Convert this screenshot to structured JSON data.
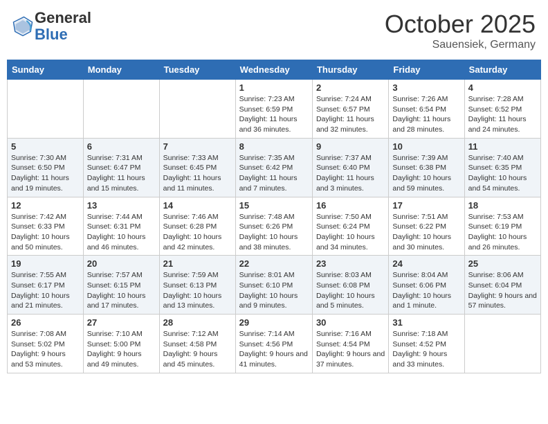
{
  "header": {
    "logo_general": "General",
    "logo_blue": "Blue",
    "month": "October 2025",
    "location": "Sauensiek, Germany"
  },
  "weekdays": [
    "Sunday",
    "Monday",
    "Tuesday",
    "Wednesday",
    "Thursday",
    "Friday",
    "Saturday"
  ],
  "weeks": [
    [
      {
        "day": "",
        "info": ""
      },
      {
        "day": "",
        "info": ""
      },
      {
        "day": "",
        "info": ""
      },
      {
        "day": "1",
        "info": "Sunrise: 7:23 AM\nSunset: 6:59 PM\nDaylight: 11 hours\nand 36 minutes."
      },
      {
        "day": "2",
        "info": "Sunrise: 7:24 AM\nSunset: 6:57 PM\nDaylight: 11 hours\nand 32 minutes."
      },
      {
        "day": "3",
        "info": "Sunrise: 7:26 AM\nSunset: 6:54 PM\nDaylight: 11 hours\nand 28 minutes."
      },
      {
        "day": "4",
        "info": "Sunrise: 7:28 AM\nSunset: 6:52 PM\nDaylight: 11 hours\nand 24 minutes."
      }
    ],
    [
      {
        "day": "5",
        "info": "Sunrise: 7:30 AM\nSunset: 6:50 PM\nDaylight: 11 hours\nand 19 minutes."
      },
      {
        "day": "6",
        "info": "Sunrise: 7:31 AM\nSunset: 6:47 PM\nDaylight: 11 hours\nand 15 minutes."
      },
      {
        "day": "7",
        "info": "Sunrise: 7:33 AM\nSunset: 6:45 PM\nDaylight: 11 hours\nand 11 minutes."
      },
      {
        "day": "8",
        "info": "Sunrise: 7:35 AM\nSunset: 6:42 PM\nDaylight: 11 hours\nand 7 minutes."
      },
      {
        "day": "9",
        "info": "Sunrise: 7:37 AM\nSunset: 6:40 PM\nDaylight: 11 hours\nand 3 minutes."
      },
      {
        "day": "10",
        "info": "Sunrise: 7:39 AM\nSunset: 6:38 PM\nDaylight: 10 hours\nand 59 minutes."
      },
      {
        "day": "11",
        "info": "Sunrise: 7:40 AM\nSunset: 6:35 PM\nDaylight: 10 hours\nand 54 minutes."
      }
    ],
    [
      {
        "day": "12",
        "info": "Sunrise: 7:42 AM\nSunset: 6:33 PM\nDaylight: 10 hours\nand 50 minutes."
      },
      {
        "day": "13",
        "info": "Sunrise: 7:44 AM\nSunset: 6:31 PM\nDaylight: 10 hours\nand 46 minutes."
      },
      {
        "day": "14",
        "info": "Sunrise: 7:46 AM\nSunset: 6:28 PM\nDaylight: 10 hours\nand 42 minutes."
      },
      {
        "day": "15",
        "info": "Sunrise: 7:48 AM\nSunset: 6:26 PM\nDaylight: 10 hours\nand 38 minutes."
      },
      {
        "day": "16",
        "info": "Sunrise: 7:50 AM\nSunset: 6:24 PM\nDaylight: 10 hours\nand 34 minutes."
      },
      {
        "day": "17",
        "info": "Sunrise: 7:51 AM\nSunset: 6:22 PM\nDaylight: 10 hours\nand 30 minutes."
      },
      {
        "day": "18",
        "info": "Sunrise: 7:53 AM\nSunset: 6:19 PM\nDaylight: 10 hours\nand 26 minutes."
      }
    ],
    [
      {
        "day": "19",
        "info": "Sunrise: 7:55 AM\nSunset: 6:17 PM\nDaylight: 10 hours\nand 21 minutes."
      },
      {
        "day": "20",
        "info": "Sunrise: 7:57 AM\nSunset: 6:15 PM\nDaylight: 10 hours\nand 17 minutes."
      },
      {
        "day": "21",
        "info": "Sunrise: 7:59 AM\nSunset: 6:13 PM\nDaylight: 10 hours\nand 13 minutes."
      },
      {
        "day": "22",
        "info": "Sunrise: 8:01 AM\nSunset: 6:10 PM\nDaylight: 10 hours\nand 9 minutes."
      },
      {
        "day": "23",
        "info": "Sunrise: 8:03 AM\nSunset: 6:08 PM\nDaylight: 10 hours\nand 5 minutes."
      },
      {
        "day": "24",
        "info": "Sunrise: 8:04 AM\nSunset: 6:06 PM\nDaylight: 10 hours\nand 1 minute."
      },
      {
        "day": "25",
        "info": "Sunrise: 8:06 AM\nSunset: 6:04 PM\nDaylight: 9 hours\nand 57 minutes."
      }
    ],
    [
      {
        "day": "26",
        "info": "Sunrise: 7:08 AM\nSunset: 5:02 PM\nDaylight: 9 hours\nand 53 minutes."
      },
      {
        "day": "27",
        "info": "Sunrise: 7:10 AM\nSunset: 5:00 PM\nDaylight: 9 hours\nand 49 minutes."
      },
      {
        "day": "28",
        "info": "Sunrise: 7:12 AM\nSunset: 4:58 PM\nDaylight: 9 hours\nand 45 minutes."
      },
      {
        "day": "29",
        "info": "Sunrise: 7:14 AM\nSunset: 4:56 PM\nDaylight: 9 hours\nand 41 minutes."
      },
      {
        "day": "30",
        "info": "Sunrise: 7:16 AM\nSunset: 4:54 PM\nDaylight: 9 hours\nand 37 minutes."
      },
      {
        "day": "31",
        "info": "Sunrise: 7:18 AM\nSunset: 4:52 PM\nDaylight: 9 hours\nand 33 minutes."
      },
      {
        "day": "",
        "info": ""
      }
    ]
  ]
}
